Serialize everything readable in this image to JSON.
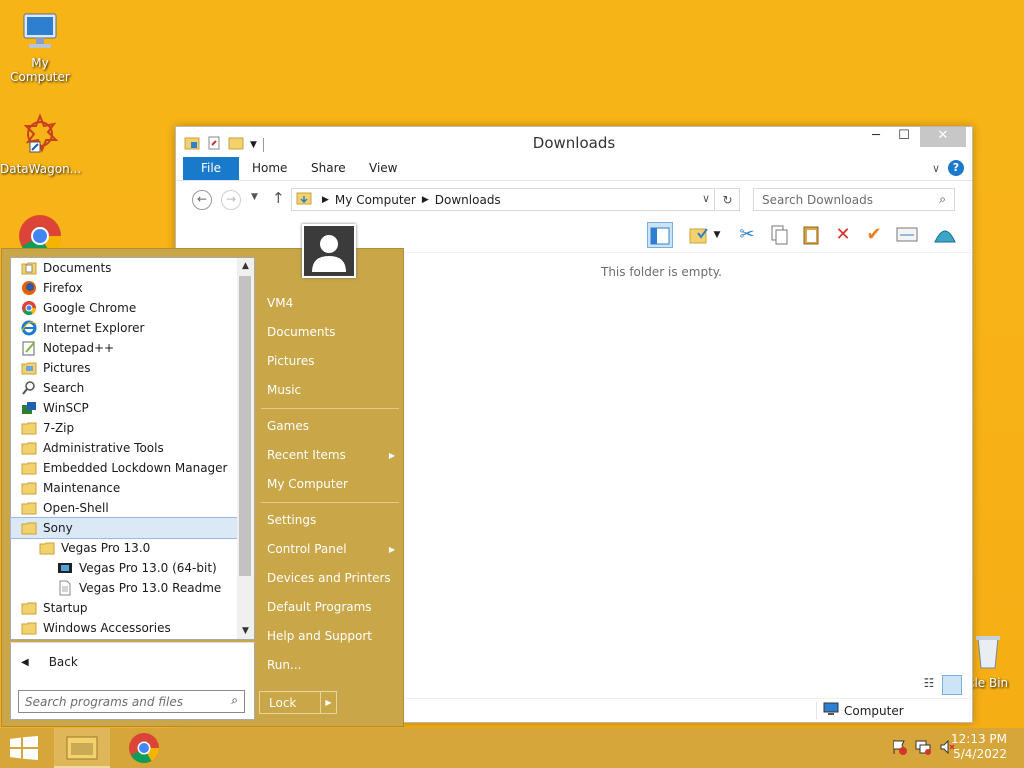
{
  "desktop": {
    "icons": [
      {
        "label": "My Computer",
        "icon": "monitor-icon"
      },
      {
        "label": "DataWagon...",
        "icon": "datawagon-shortcut-icon"
      },
      {
        "label": "",
        "icon": "chrome-icon"
      },
      {
        "label": "cle Bin",
        "icon": "recycle-bin-icon"
      }
    ]
  },
  "explorer": {
    "title": "Downloads",
    "ribbon_tabs": [
      "File",
      "Home",
      "Share",
      "View"
    ],
    "breadcrumb": [
      "My Computer",
      "Downloads"
    ],
    "search_placeholder": "Search Downloads",
    "empty_message": "This folder is empty.",
    "status_location": "Computer"
  },
  "start_menu": {
    "programs": [
      {
        "label": "Documents",
        "icon": "folder-doc-icon",
        "indent": 0
      },
      {
        "label": "Firefox",
        "icon": "firefox-icon",
        "indent": 0
      },
      {
        "label": "Google Chrome",
        "icon": "chrome-icon",
        "indent": 0
      },
      {
        "label": "Internet Explorer",
        "icon": "ie-icon",
        "indent": 0
      },
      {
        "label": "Notepad++",
        "icon": "notepadpp-icon",
        "indent": 0
      },
      {
        "label": "Pictures",
        "icon": "folder-pictures-icon",
        "indent": 0
      },
      {
        "label": "Search",
        "icon": "search-icon",
        "indent": 0
      },
      {
        "label": "WinSCP",
        "icon": "winscp-icon",
        "indent": 0
      },
      {
        "label": "7-Zip",
        "icon": "folder-icon",
        "indent": 0
      },
      {
        "label": "Administrative Tools",
        "icon": "folder-icon",
        "indent": 0
      },
      {
        "label": "Embedded Lockdown Manager",
        "icon": "folder-icon",
        "indent": 0
      },
      {
        "label": "Maintenance",
        "icon": "folder-icon",
        "indent": 0
      },
      {
        "label": "Open-Shell",
        "icon": "folder-icon",
        "indent": 0
      },
      {
        "label": "Sony",
        "icon": "folder-icon",
        "indent": 0,
        "selected": true
      },
      {
        "label": "Vegas Pro 13.0",
        "icon": "folder-icon",
        "indent": 1
      },
      {
        "label": "Vegas Pro 13.0 (64-bit)",
        "icon": "vegas-icon",
        "indent": 2
      },
      {
        "label": "Vegas Pro 13.0 Readme",
        "icon": "document-icon",
        "indent": 2
      },
      {
        "label": "Startup",
        "icon": "folder-icon",
        "indent": 0
      },
      {
        "label": "Windows Accessories",
        "icon": "folder-icon",
        "indent": 0
      }
    ],
    "back_label": "Back",
    "search_placeholder": "Search programs and files",
    "right_items": [
      {
        "label": "VM4",
        "submenu": false
      },
      {
        "label": "Documents",
        "submenu": false
      },
      {
        "label": "Pictures",
        "submenu": false
      },
      {
        "label": "Music",
        "submenu": false
      },
      {
        "sep": true
      },
      {
        "label": "Games",
        "submenu": false
      },
      {
        "label": "Recent Items",
        "submenu": true
      },
      {
        "label": "My Computer",
        "submenu": false
      },
      {
        "sep": true
      },
      {
        "label": "Settings",
        "submenu": false
      },
      {
        "label": "Control Panel",
        "submenu": true
      },
      {
        "label": "Devices and Printers",
        "submenu": false
      },
      {
        "label": "Default Programs",
        "submenu": false
      },
      {
        "label": "Help and Support",
        "submenu": false
      },
      {
        "label": "Run...",
        "submenu": false
      }
    ],
    "lock_label": "Lock"
  },
  "taskbar": {
    "time": "12:13 PM",
    "date": "5/4/2022"
  }
}
